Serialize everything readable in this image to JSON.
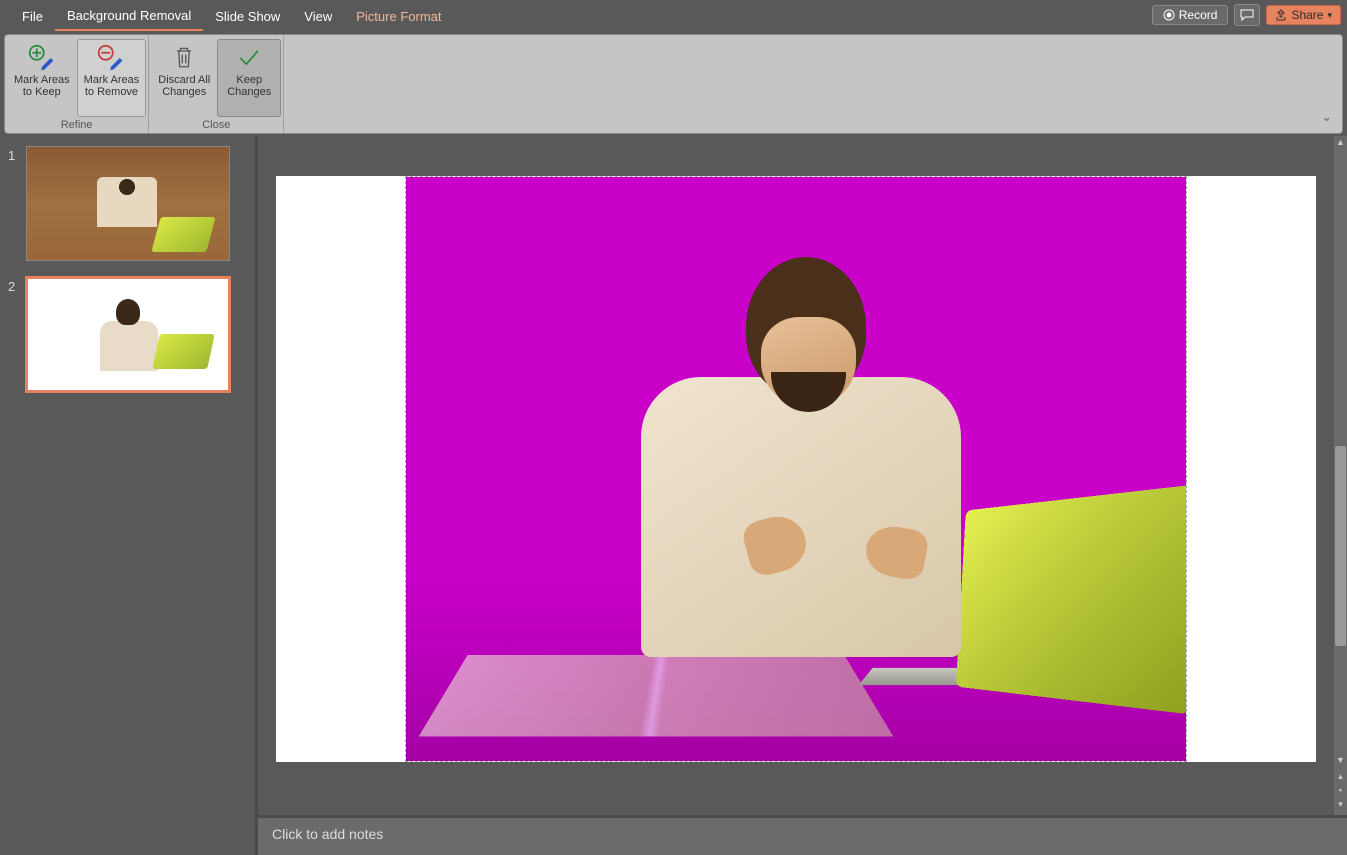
{
  "tabs": {
    "file": "File",
    "background_removal": "Background Removal",
    "slide_show": "Slide Show",
    "view": "View",
    "picture_format": "Picture Format"
  },
  "top_right": {
    "record": "Record",
    "share": "Share"
  },
  "ribbon": {
    "refine": {
      "label": "Refine",
      "mark_keep_l1": "Mark Areas",
      "mark_keep_l2": "to Keep",
      "mark_remove_l1": "Mark Areas",
      "mark_remove_l2": "to Remove"
    },
    "close": {
      "label": "Close",
      "discard_l1": "Discard All",
      "discard_l2": "Changes",
      "keep_l1": "Keep",
      "keep_l2": "Changes"
    }
  },
  "slides": {
    "s1": "1",
    "s2": "2"
  },
  "notes": {
    "placeholder": "Click to add notes"
  }
}
